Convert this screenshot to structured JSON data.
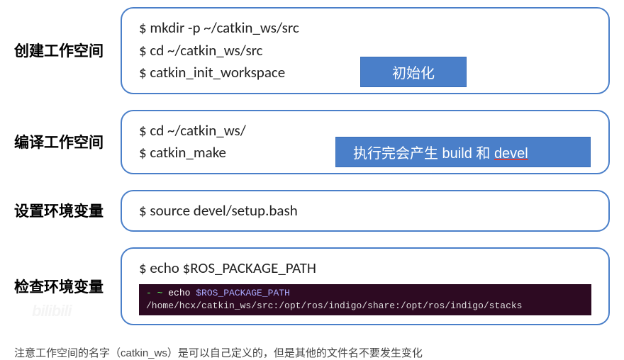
{
  "sections": [
    {
      "label": "创建工作空间",
      "commands": [
        "$ mkdir -p ~/catkin_ws/src",
        "$ cd ~/catkin_ws/src",
        "$ catkin_init_workspace"
      ],
      "tag": {
        "text": "初始化",
        "class": "tag1"
      }
    },
    {
      "label": "编译工作空间",
      "commands": [
        "$ cd ~/catkin_ws/",
        "$ catkin_make"
      ],
      "tag": {
        "prefix": "执行完会产生 build 和 ",
        "suffix": "devel",
        "class": "tag2"
      }
    },
    {
      "label": "设置环境变量",
      "commands": [
        "$ source devel/setup.bash"
      ]
    },
    {
      "label": "检查环境变量",
      "commands": [
        "$ echo $ROS_PACKAGE_PATH"
      ],
      "terminal": {
        "prompt": "- ~ ",
        "cmd_prefix": "echo ",
        "cmd_var": "$ROS_PACKAGE_PATH",
        "output": "/home/hcx/catkin_ws/src:/opt/ros/indigo/share:/opt/ros/indigo/stacks"
      }
    }
  ],
  "note": "注意工作空间的名字（catkin_ws）是可以自己定义的，但是其他的文件名不要发生变化",
  "watermark": "bilibili"
}
